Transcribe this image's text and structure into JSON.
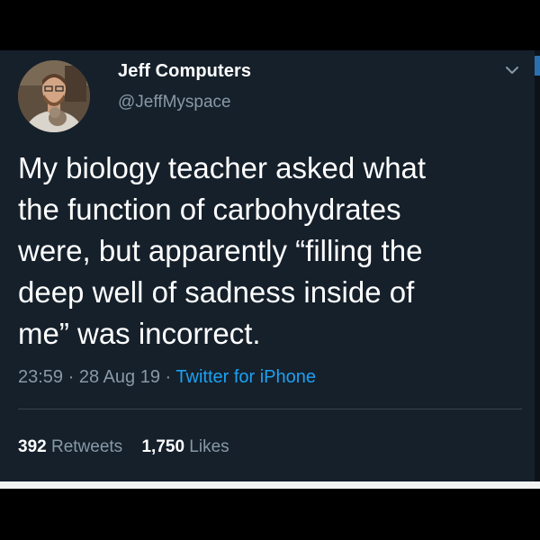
{
  "tweet": {
    "author": {
      "display_name": "Jeff Computers",
      "handle": "@JeffMyspace"
    },
    "text": "My biology teacher asked what\nthe function of carbohydrates\nwere, but apparently “filling the\ndeep well of sadness inside of\nme” was incorrect.",
    "time": "23:59",
    "date": "28 Aug 19",
    "source": "Twitter for iPhone",
    "separator": "·",
    "retweets": {
      "count": "392",
      "label": "Retweets"
    },
    "likes": {
      "count": "1,750",
      "label": "Likes"
    },
    "menu_icon": "chevron-down-icon"
  },
  "colors": {
    "card_background": "#15202b",
    "primary_text": "#ffffff",
    "secondary_text": "#8899a6",
    "link": "#1da1f2",
    "divider": "#38444d"
  }
}
